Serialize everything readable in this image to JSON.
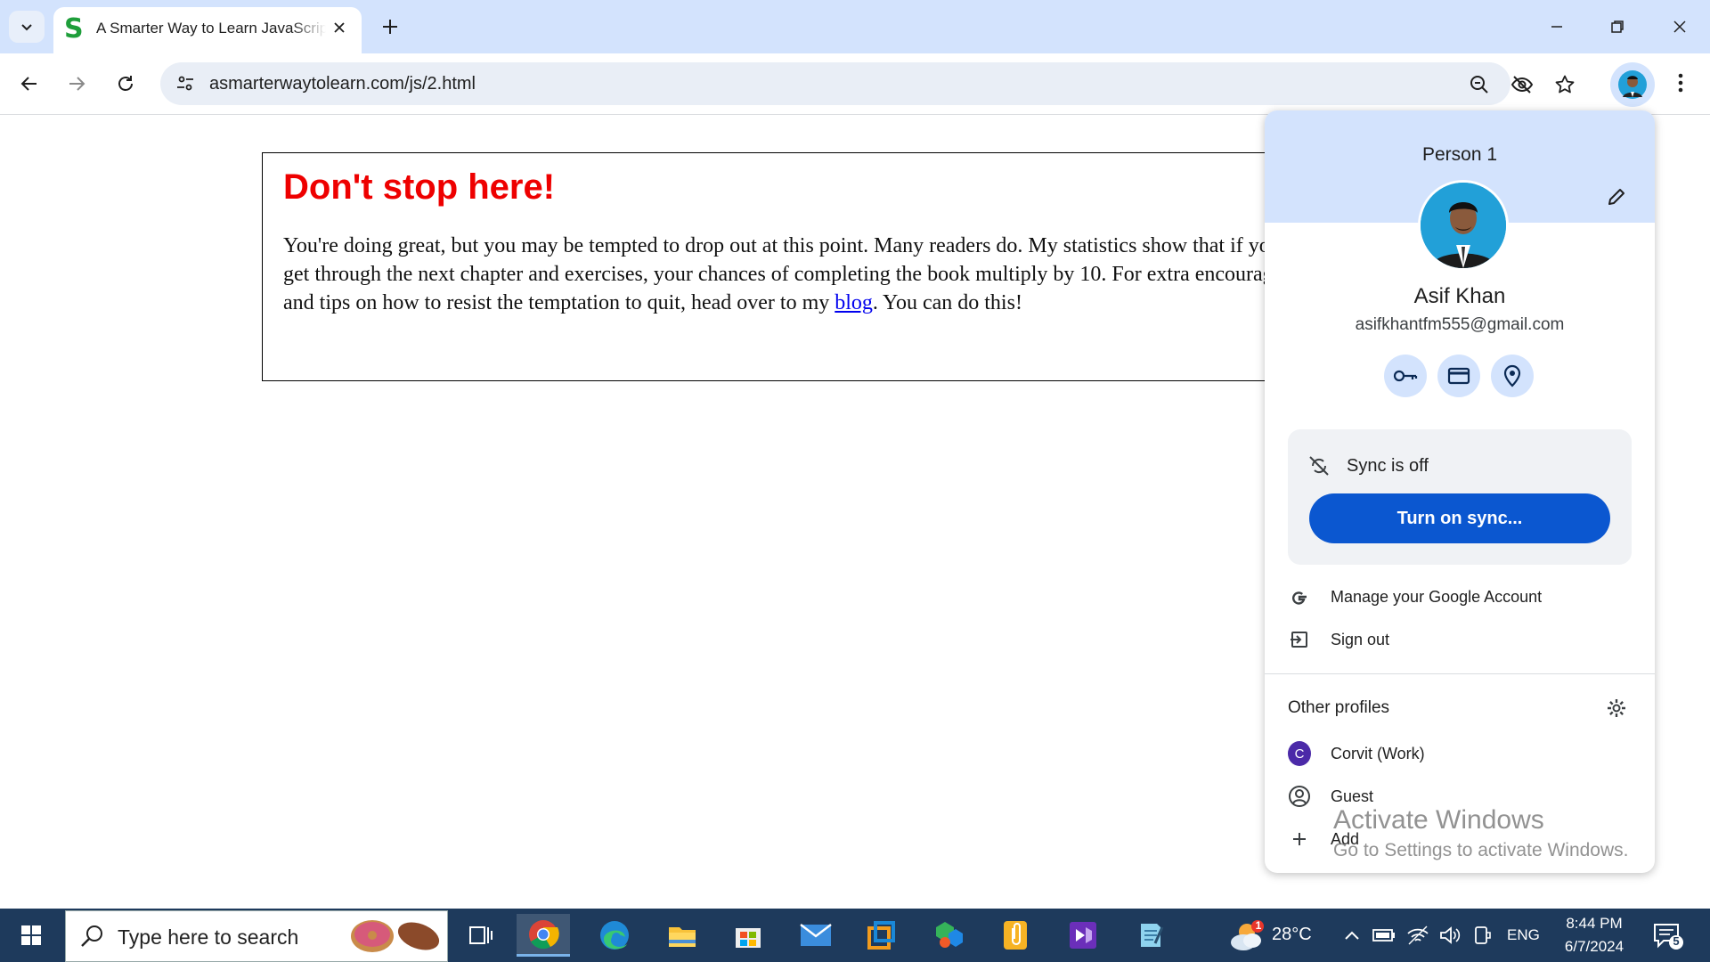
{
  "browser": {
    "tab": {
      "favicon": "S",
      "title": "A Smarter Way to Learn JavaScript"
    },
    "url": "asmarterwaytolearn.com/js/2.html"
  },
  "page": {
    "heading": "Don't stop here!",
    "para_before_link": "You're doing great, but you may be tempted to drop out at this point. Many readers do. My statistics show that if you can just get through the next chapter and exercises, your chances of completing the book multiply by 10. For extra encouragement and tips on how to resist the temptation to quit, head over to my ",
    "link_text": "blog",
    "para_after_link": ". You can do this!"
  },
  "profile_menu": {
    "title": "Person 1",
    "name": "Asif Khan",
    "email": "asifkhantfm555@gmail.com",
    "quick_icons": [
      "key-icon",
      "credit-card-icon",
      "location-pin-icon"
    ],
    "sync_status": "Sync is off",
    "sync_button": "Turn on sync...",
    "manage_account": "Manage your Google Account",
    "sign_out": "Sign out",
    "other_profiles_title": "Other profiles",
    "profiles": [
      {
        "initial": "C",
        "label": "Corvit (Work)"
      },
      {
        "label": "Guest"
      },
      {
        "label": "Add"
      }
    ]
  },
  "watermark": {
    "line1": "Activate Windows",
    "line2": "Go to Settings to activate Windows."
  },
  "taskbar": {
    "search_placeholder": "Type here to search",
    "weather_badge": "1",
    "temperature": "28°C",
    "language": "ENG",
    "time": "8:44 PM",
    "date": "6/7/2024",
    "notification_count": "5"
  },
  "colors": {
    "accent": "#0b57d0",
    "tabstrip": "#d3e3fd",
    "heading": "#ee0000",
    "taskbar": "#1e3a5c"
  }
}
